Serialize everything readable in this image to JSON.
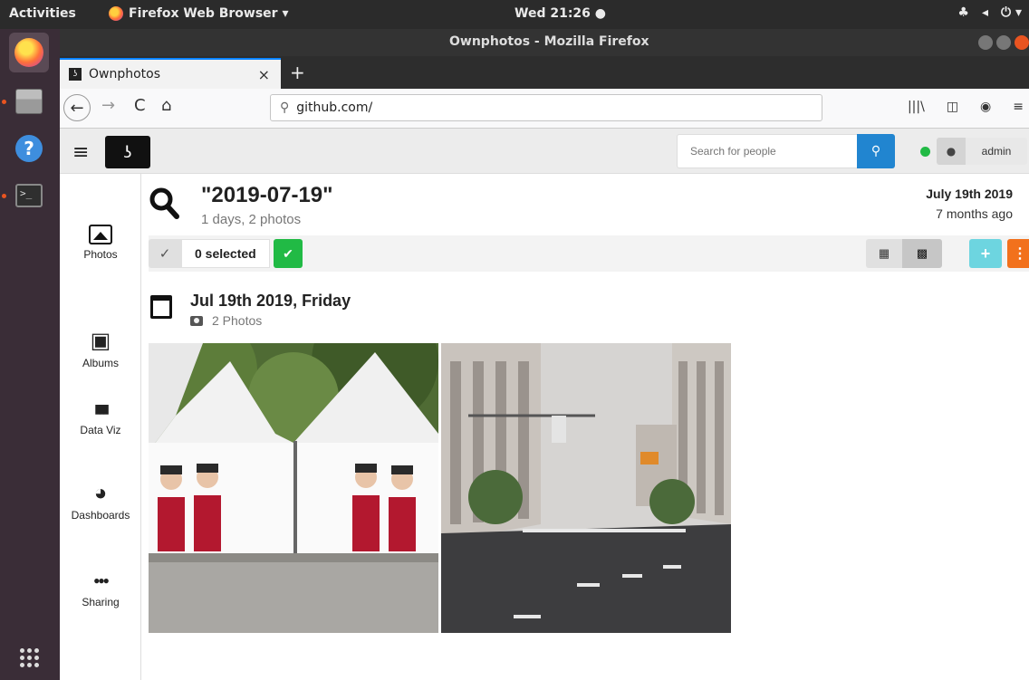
{
  "os": {
    "activities": "Activities",
    "app_menu": "Firefox Web Browser ▾",
    "clock": "Wed 21:26 ●",
    "tray": [
      "♣",
      "◂",
      "⏻ ▾"
    ]
  },
  "window": {
    "title": "Ownphotos - Mozilla Firefox"
  },
  "tab": {
    "label": "Ownphotos",
    "close": "×",
    "new_tab": "+"
  },
  "nav": {
    "back": "←",
    "forward": "→",
    "reload": "C",
    "home": "⌂",
    "url": "github.com/",
    "search_glyph": "⚲",
    "library": "|||\\",
    "sidebar": "◫",
    "account": "◉",
    "menu": "≡"
  },
  "app": {
    "menu_glyph": "≡",
    "logo_glyph": "ʖ",
    "search_placeholder": "Search for people",
    "search_btn": "⚲",
    "user_glyph": "●",
    "username": "admin"
  },
  "sidebar": {
    "items": [
      {
        "label": "Photos",
        "icon": "photo-icon"
      },
      {
        "label": "Albums",
        "icon": "albums-icon"
      },
      {
        "label": "Data Viz",
        "icon": "chart-icon"
      },
      {
        "label": "Dashboards",
        "icon": "dashboard-icon"
      },
      {
        "label": "Sharing",
        "icon": "users-icon"
      }
    ],
    "glyphs": {
      "albums": "▣",
      "dataviz": "▮▮▮",
      "dashboards": "◕",
      "sharing": "●●●"
    }
  },
  "main": {
    "title": "\"2019-07-19\"",
    "subtitle": "1 days, 2 photos",
    "date": "July 19th 2019",
    "ago": "7 months ago",
    "check": "✓",
    "selected": "0 selected",
    "sel_ok": "✔",
    "view_grid": "▦",
    "view_big": "▩",
    "add": "+",
    "more": "⋮",
    "group": {
      "title": "Jul 19th 2019, Friday",
      "count": "2 Photos"
    }
  }
}
